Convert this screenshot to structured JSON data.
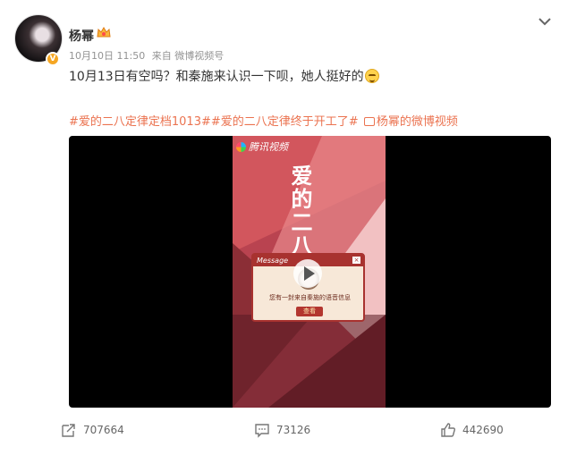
{
  "post": {
    "username": "杨幂",
    "date": "10月10日 11:50",
    "source": "来自 微博视频号",
    "text": "10月13日有空吗？和秦施来认识一下呗，她人挺好的",
    "topics": [
      "#爱的二八定律定档1013#",
      "#爱的二八定律终于开工了#"
    ],
    "video_link": "杨幂的微博视频",
    "video": {
      "platform_logo": "腾讯视频",
      "title_art": "爱的二八定律",
      "message_header": "Message",
      "message_text": "您有一封来自秦施的语音信息",
      "message_button": "查看",
      "close_glyph": "×"
    }
  },
  "actions": {
    "forward_count": "707664",
    "comment_count": "73126",
    "like_count": "442690"
  },
  "colors": {
    "topic": "#eb7350",
    "poster_red": "#b7444c",
    "verified": "#f5a623"
  },
  "icons": [
    "chevron-down-icon",
    "verified-icon",
    "member-crown-icon",
    "emoji-icon",
    "video-link-icon",
    "play-icon",
    "forward-icon",
    "comment-icon",
    "like-icon"
  ]
}
